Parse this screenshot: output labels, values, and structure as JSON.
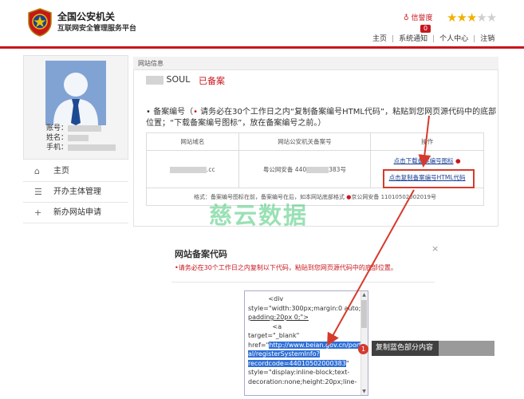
{
  "header": {
    "org_title": "全国公安机关",
    "org_subtitle": "互联网安全管理服务平台",
    "credit_label": "信誉度",
    "credit_value": "0",
    "stars_on": "★★★",
    "stars_off": "★★",
    "rating": 3,
    "rating_max": 5,
    "nav": [
      "主页",
      "系统通知",
      "个人中心",
      "注销"
    ]
  },
  "account": {
    "account_label": "账号：",
    "name_label": "姓名：",
    "phone_label": "手机："
  },
  "sidebar": {
    "items": [
      {
        "icon": "home-icon",
        "glyph": "⌂",
        "label": "主页"
      },
      {
        "icon": "list-icon",
        "glyph": "☰",
        "label": "开办主体管理"
      },
      {
        "icon": "plus-icon",
        "glyph": "+",
        "label": "新办网站申请"
      }
    ]
  },
  "panel": {
    "title": "网站信息",
    "site_name": "SOUL",
    "site_status": "已备案",
    "note_prefix": "• 备案编号（",
    "note_red": "•",
    "note_text": " 请务必在30个工作日之内“复制备案编号HTML代码”，粘贴到您网页源代码中的底部位置；“下载备案编号图标”，放在备案编号之前。）"
  },
  "table": {
    "headers": [
      "网站域名",
      "网站公安机关备案号",
      "操作"
    ],
    "domain_suffix": ".cc",
    "record_prefix": "粤公网安备 440",
    "record_suffix": "383号",
    "download_link": "点击下载备案编号图标",
    "copy_link": "点击复制备案编号HTML代码",
    "format_note": "格式：备案编号图标在前，备案编号在后，如本网站底部格式",
    "format_example": "京公网安备 11010502002019号"
  },
  "watermark": "慈云数据",
  "modal": {
    "title": "网站备案代码",
    "note": "•请务必在30个工作日之内复制以下代码，粘贴到您网页源代码中的底部位置。",
    "close": "×",
    "code_lines": [
      "          <div",
      "style=\"width:300px;margin:0 auto;",
      "padding:20px 0;\">",
      "            <a",
      "target=\"_blank\"",
      "href=\"",
      "http://www.beian.gov.cn/port",
      "al/registerSystemInfo?",
      "recordcode=44010502000383",
      "\"",
      "style=\"display:inline-block;text-",
      "decoration:none;height:20px;line-"
    ]
  },
  "callout": {
    "number": "1",
    "text": "复制蓝色部分内容"
  }
}
